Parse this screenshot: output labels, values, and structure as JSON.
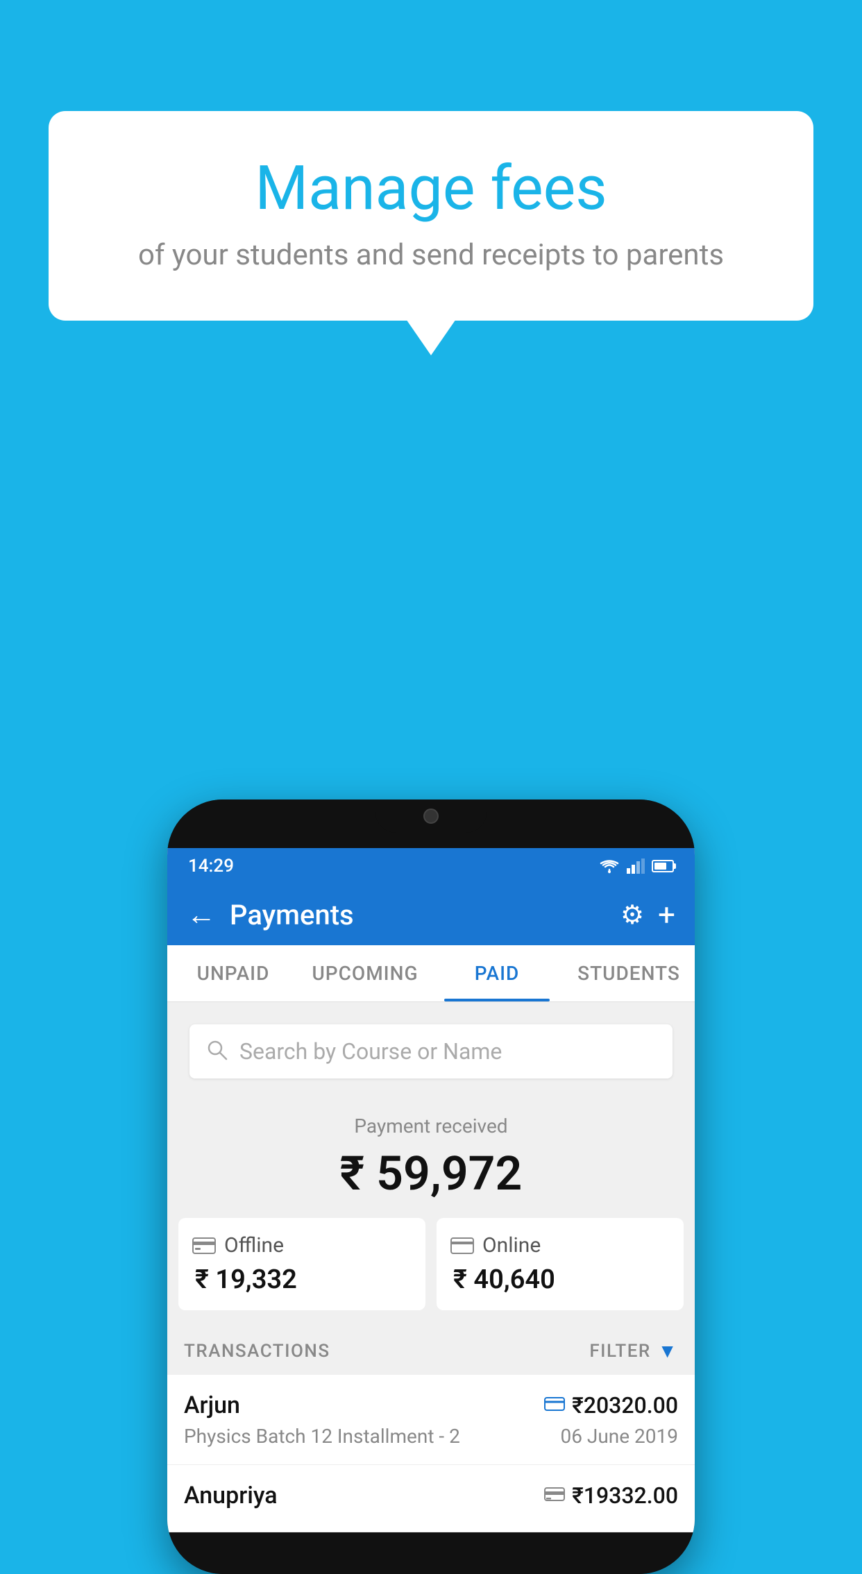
{
  "background_color": "#1ab4e8",
  "bubble": {
    "title": "Manage fees",
    "subtitle": "of your students and send receipts to parents"
  },
  "phone": {
    "status_bar": {
      "time": "14:29"
    },
    "header": {
      "title": "Payments",
      "back_label": "←",
      "settings_label": "⚙",
      "add_label": "+"
    },
    "tabs": [
      {
        "label": "UNPAID",
        "active": false
      },
      {
        "label": "UPCOMING",
        "active": false
      },
      {
        "label": "PAID",
        "active": true
      },
      {
        "label": "STUDENTS",
        "active": false
      }
    ],
    "search": {
      "placeholder": "Search by Course or Name"
    },
    "payment_summary": {
      "label": "Payment received",
      "amount": "₹ 59,972"
    },
    "payment_cards": [
      {
        "type": "Offline",
        "amount": "₹ 19,332",
        "icon": "💳"
      },
      {
        "type": "Online",
        "amount": "₹ 40,640",
        "icon": "💳"
      }
    ],
    "transactions_header": {
      "label": "TRANSACTIONS",
      "filter_label": "FILTER"
    },
    "transactions": [
      {
        "name": "Arjun",
        "course": "Physics Batch 12 Installment - 2",
        "amount": "₹20320.00",
        "date": "06 June 2019",
        "payment_type": "online"
      },
      {
        "name": "Anupriya",
        "course": "",
        "amount": "₹19332.00",
        "date": "",
        "payment_type": "offline"
      }
    ]
  }
}
